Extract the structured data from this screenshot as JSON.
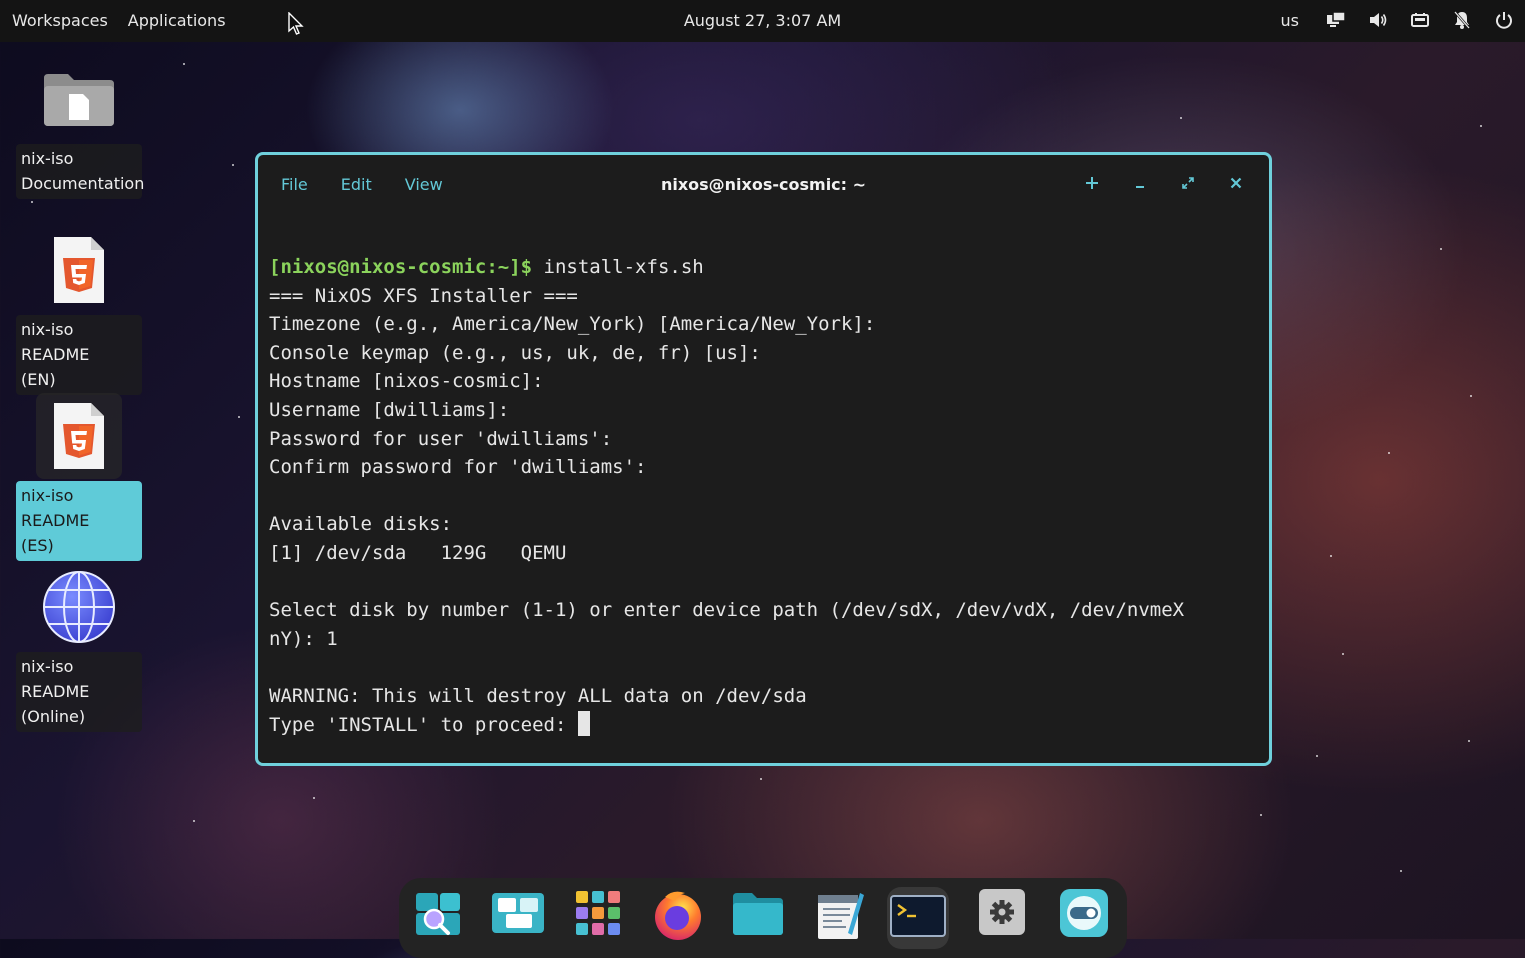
{
  "top_panel": {
    "workspaces_label": "Workspaces",
    "applications_label": "Applications",
    "clock": "August 27, 3:07 AM",
    "keyboard_layout": "us",
    "tray_icons": [
      "display-icon",
      "volume-icon",
      "battery-icon",
      "notifications-off-icon",
      "power-icon"
    ]
  },
  "desktop": {
    "items": [
      {
        "line1": "nix-iso",
        "line2": "Documentation",
        "icon": "folder-icon",
        "selected": false
      },
      {
        "line1": "nix-iso README",
        "line2": "(EN)",
        "icon": "html5-file-icon",
        "selected": false
      },
      {
        "line1": "nix-iso README",
        "line2": "(ES)",
        "icon": "html5-file-icon",
        "selected": true
      },
      {
        "line1": "nix-iso README",
        "line2": "(Online)",
        "icon": "globe-icon",
        "selected": false
      }
    ]
  },
  "terminal": {
    "menu": {
      "file": "File",
      "edit": "Edit",
      "view": "View"
    },
    "title": "nixos@nixos-cosmic: ~",
    "prompt": "[nixos@nixos-cosmic:~]$",
    "command": " install-xfs.sh",
    "lines": [
      "=== NixOS XFS Installer ===",
      "Timezone (e.g., America/New_York) [America/New_York]:",
      "Console keymap (e.g., us, uk, de, fr) [us]:",
      "Hostname [nixos-cosmic]:",
      "Username [dwilliams]:",
      "Password for user 'dwilliams':",
      "Confirm password for 'dwilliams':",
      "",
      "Available disks:",
      "[1] /dev/sda   129G   QEMU",
      "",
      "Select disk by number (1-1) or enter device path (/dev/sdX, /dev/vdX, /dev/nvmeX",
      "nY): 1",
      "",
      "WARNING: This will destroy ALL data on /dev/sda",
      "Type 'INSTALL' to proceed: "
    ]
  },
  "dock": {
    "items": [
      "launcher-search-icon",
      "workspaces-overview-icon",
      "app-library-icon",
      "firefox-icon",
      "files-icon",
      "text-editor-icon",
      "terminal-icon",
      "settings-icon",
      "store-icon"
    ],
    "active": "terminal-icon"
  },
  "colors": {
    "accent": "#63c8d6",
    "window_border": "#6fd0dc",
    "prompt_green": "#8bd35c",
    "terminal_bg": "#1c1c1c"
  }
}
